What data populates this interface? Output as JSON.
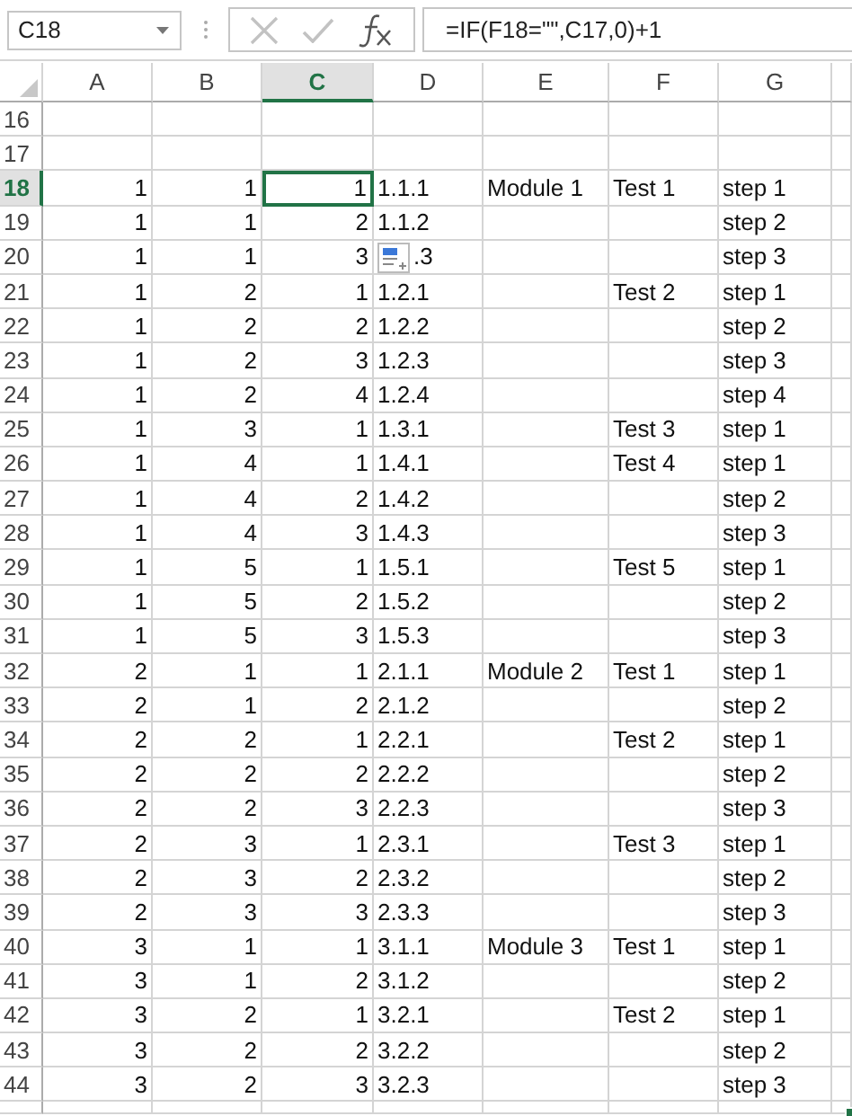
{
  "formula_bar": {
    "name_box": "C18",
    "formula": "=IF(F18=\"\",C17,0)+1"
  },
  "columns": [
    {
      "label": "A",
      "kind": "number",
      "selected": false
    },
    {
      "label": "B",
      "kind": "number",
      "selected": false
    },
    {
      "label": "C",
      "kind": "number",
      "selected": true
    },
    {
      "label": "D",
      "kind": "text",
      "selected": false
    },
    {
      "label": "E",
      "kind": "text",
      "selected": false
    },
    {
      "label": "F",
      "kind": "text",
      "selected": false
    },
    {
      "label": "G",
      "kind": "text",
      "selected": false
    }
  ],
  "rows": [
    {
      "header": "16",
      "selected": false,
      "cells": {}
    },
    {
      "header": "17",
      "selected": false,
      "cells": {}
    },
    {
      "header": "18",
      "selected": true,
      "cells": {
        "A": "1",
        "B": "1",
        "C": "1",
        "D": "1.1.1",
        "E": "Module 1",
        "F": "Test 1",
        "G": "step 1"
      }
    },
    {
      "header": "19",
      "selected": false,
      "cells": {
        "A": "1",
        "B": "1",
        "C": "2",
        "D": "1.1.2",
        "G": "step 2"
      }
    },
    {
      "header": "20",
      "selected": false,
      "paste_options": true,
      "cells": {
        "A": "1",
        "B": "1",
        "C": "3",
        "D": ".3",
        "G": "step 3"
      }
    },
    {
      "header": "21",
      "selected": false,
      "cells": {
        "A": "1",
        "B": "2",
        "C": "1",
        "D": "1.2.1",
        "F": "Test 2",
        "G": "step 1"
      }
    },
    {
      "header": "22",
      "selected": false,
      "cells": {
        "A": "1",
        "B": "2",
        "C": "2",
        "D": "1.2.2",
        "G": "step 2"
      }
    },
    {
      "header": "23",
      "selected": false,
      "cells": {
        "A": "1",
        "B": "2",
        "C": "3",
        "D": "1.2.3",
        "G": "step 3"
      }
    },
    {
      "header": "24",
      "selected": false,
      "cells": {
        "A": "1",
        "B": "2",
        "C": "4",
        "D": "1.2.4",
        "G": "step 4"
      }
    },
    {
      "header": "25",
      "selected": false,
      "cells": {
        "A": "1",
        "B": "3",
        "C": "1",
        "D": "1.3.1",
        "F": "Test 3",
        "G": "step 1"
      }
    },
    {
      "header": "26",
      "selected": false,
      "cells": {
        "A": "1",
        "B": "4",
        "C": "1",
        "D": "1.4.1",
        "F": "Test 4",
        "G": "step 1"
      }
    },
    {
      "header": "27",
      "selected": false,
      "cells": {
        "A": "1",
        "B": "4",
        "C": "2",
        "D": "1.4.2",
        "G": "step 2"
      }
    },
    {
      "header": "28",
      "selected": false,
      "cells": {
        "A": "1",
        "B": "4",
        "C": "3",
        "D": "1.4.3",
        "G": "step 3"
      }
    },
    {
      "header": "29",
      "selected": false,
      "cells": {
        "A": "1",
        "B": "5",
        "C": "1",
        "D": "1.5.1",
        "F": "Test 5",
        "G": "step 1"
      }
    },
    {
      "header": "30",
      "selected": false,
      "cells": {
        "A": "1",
        "B": "5",
        "C": "2",
        "D": "1.5.2",
        "G": "step 2"
      }
    },
    {
      "header": "31",
      "selected": false,
      "cells": {
        "A": "1",
        "B": "5",
        "C": "3",
        "D": "1.5.3",
        "G": "step 3"
      }
    },
    {
      "header": "32",
      "selected": false,
      "cells": {
        "A": "2",
        "B": "1",
        "C": "1",
        "D": "2.1.1",
        "E": "Module 2",
        "F": "Test 1",
        "G": "step 1"
      }
    },
    {
      "header": "33",
      "selected": false,
      "cells": {
        "A": "2",
        "B": "1",
        "C": "2",
        "D": "2.1.2",
        "G": "step 2"
      }
    },
    {
      "header": "34",
      "selected": false,
      "cells": {
        "A": "2",
        "B": "2",
        "C": "1",
        "D": "2.2.1",
        "F": "Test 2",
        "G": "step 1"
      }
    },
    {
      "header": "35",
      "selected": false,
      "cells": {
        "A": "2",
        "B": "2",
        "C": "2",
        "D": "2.2.2",
        "G": "step 2"
      }
    },
    {
      "header": "36",
      "selected": false,
      "cells": {
        "A": "2",
        "B": "2",
        "C": "3",
        "D": "2.2.3",
        "G": "step 3"
      }
    },
    {
      "header": "37",
      "selected": false,
      "cells": {
        "A": "2",
        "B": "3",
        "C": "1",
        "D": "2.3.1",
        "F": "Test 3",
        "G": "step 1"
      }
    },
    {
      "header": "38",
      "selected": false,
      "cells": {
        "A": "2",
        "B": "3",
        "C": "2",
        "D": "2.3.2",
        "G": "step 2"
      }
    },
    {
      "header": "39",
      "selected": false,
      "cells": {
        "A": "2",
        "B": "3",
        "C": "3",
        "D": "2.3.3",
        "G": "step 3"
      }
    },
    {
      "header": "40",
      "selected": false,
      "cells": {
        "A": "3",
        "B": "1",
        "C": "1",
        "D": "3.1.1",
        "E": "Module 3",
        "F": "Test 1",
        "G": "step 1"
      }
    },
    {
      "header": "41",
      "selected": false,
      "cells": {
        "A": "3",
        "B": "1",
        "C": "2",
        "D": "3.1.2",
        "G": "step 2"
      }
    },
    {
      "header": "42",
      "selected": false,
      "cells": {
        "A": "3",
        "B": "2",
        "C": "1",
        "D": "3.2.1",
        "F": "Test 2",
        "G": "step 1"
      }
    },
    {
      "header": "43",
      "selected": false,
      "cells": {
        "A": "3",
        "B": "2",
        "C": "2",
        "D": "3.2.2",
        "G": "step 2"
      }
    },
    {
      "header": "44",
      "selected": false,
      "cells": {
        "A": "3",
        "B": "2",
        "C": "3",
        "D": "3.2.3",
        "G": "step 3"
      }
    }
  ]
}
